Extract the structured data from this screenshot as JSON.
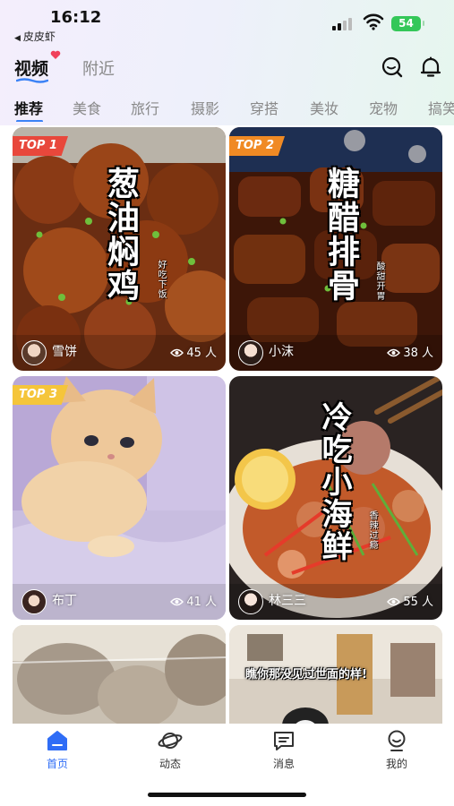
{
  "status_bar": {
    "time": "16:12",
    "back_app": "皮皮虾",
    "battery": "54"
  },
  "header": {
    "tabs": [
      {
        "label": "视频",
        "active": true
      },
      {
        "label": "附近",
        "active": false
      }
    ],
    "icons": [
      "search-icon",
      "bell-icon"
    ]
  },
  "categories": [
    "推荐",
    "美食",
    "旅行",
    "摄影",
    "穿搭",
    "美妆",
    "宠物",
    "搞笑"
  ],
  "active_category": "推荐",
  "feed": [
    {
      "badge": "TOP 1",
      "badge_color": "#e8473b",
      "title": "葱油焖鸡",
      "subtitle": "好吃下饭",
      "user": "雪饼",
      "viewers": "45 人"
    },
    {
      "badge": "TOP 2",
      "badge_color": "#f08a24",
      "title": "糖醋排骨",
      "subtitle": "酸甜开胃",
      "user": "小沫",
      "viewers": "38 人"
    },
    {
      "badge": "TOP 3",
      "badge_color": "#f5c53a",
      "title": "",
      "subtitle": "",
      "user": "布丁",
      "viewers": "41 人"
    },
    {
      "badge": "",
      "badge_color": "",
      "title": "冷吃小海鲜",
      "subtitle": "香辣过瘾",
      "user": "林三三",
      "viewers": "55 人"
    },
    {
      "badge": "",
      "title": "",
      "user": "",
      "viewers": ""
    },
    {
      "badge": "",
      "title": "",
      "caption": "瞧你那没见过世面的样!",
      "user": "",
      "viewers": ""
    }
  ],
  "bottom_nav": [
    {
      "label": "首页",
      "icon": "home-icon",
      "active": true
    },
    {
      "label": "动态",
      "icon": "planet-icon",
      "active": false
    },
    {
      "label": "消息",
      "icon": "message-icon",
      "active": false
    },
    {
      "label": "我的",
      "icon": "profile-icon",
      "active": false
    }
  ],
  "colors": {
    "accent": "#2f6df6",
    "battery": "#34c759"
  }
}
